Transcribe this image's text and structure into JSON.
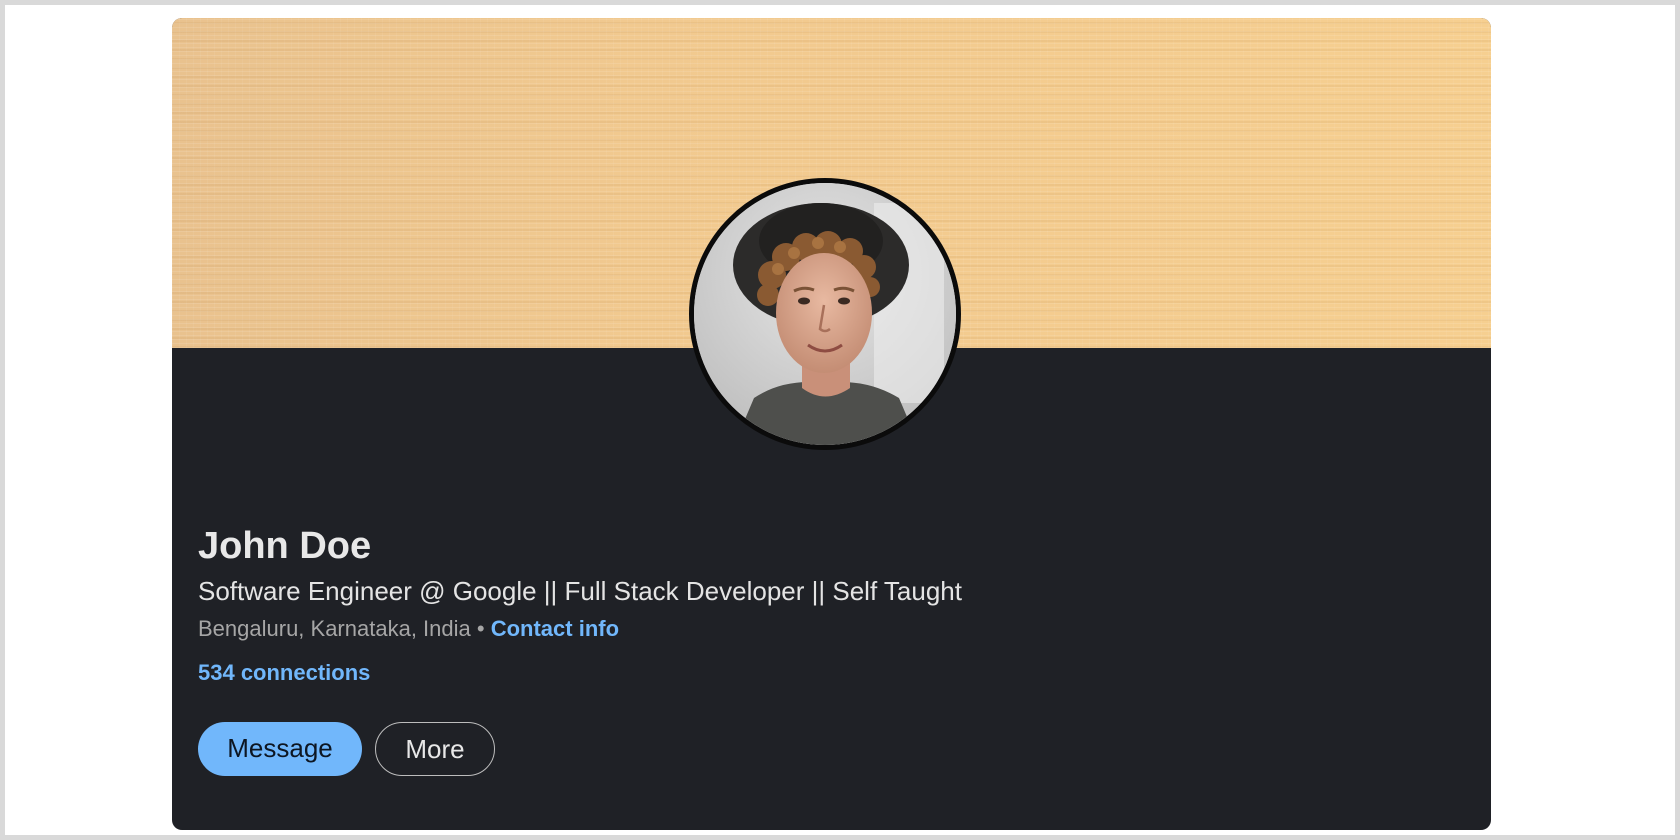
{
  "profile": {
    "name": "John Doe",
    "headline": "Software Engineer @ Google || Full Stack Developer || Self Taught",
    "location": "Bengaluru, Karnataka, India",
    "separator": "•",
    "contact_info_label": "Contact info",
    "connections_label": "534 connections"
  },
  "actions": {
    "message_label": "Message",
    "more_label": "More"
  },
  "colors": {
    "card_background": "#1f2126",
    "accent": "#71b7fb",
    "cover": "#f1c98f"
  }
}
